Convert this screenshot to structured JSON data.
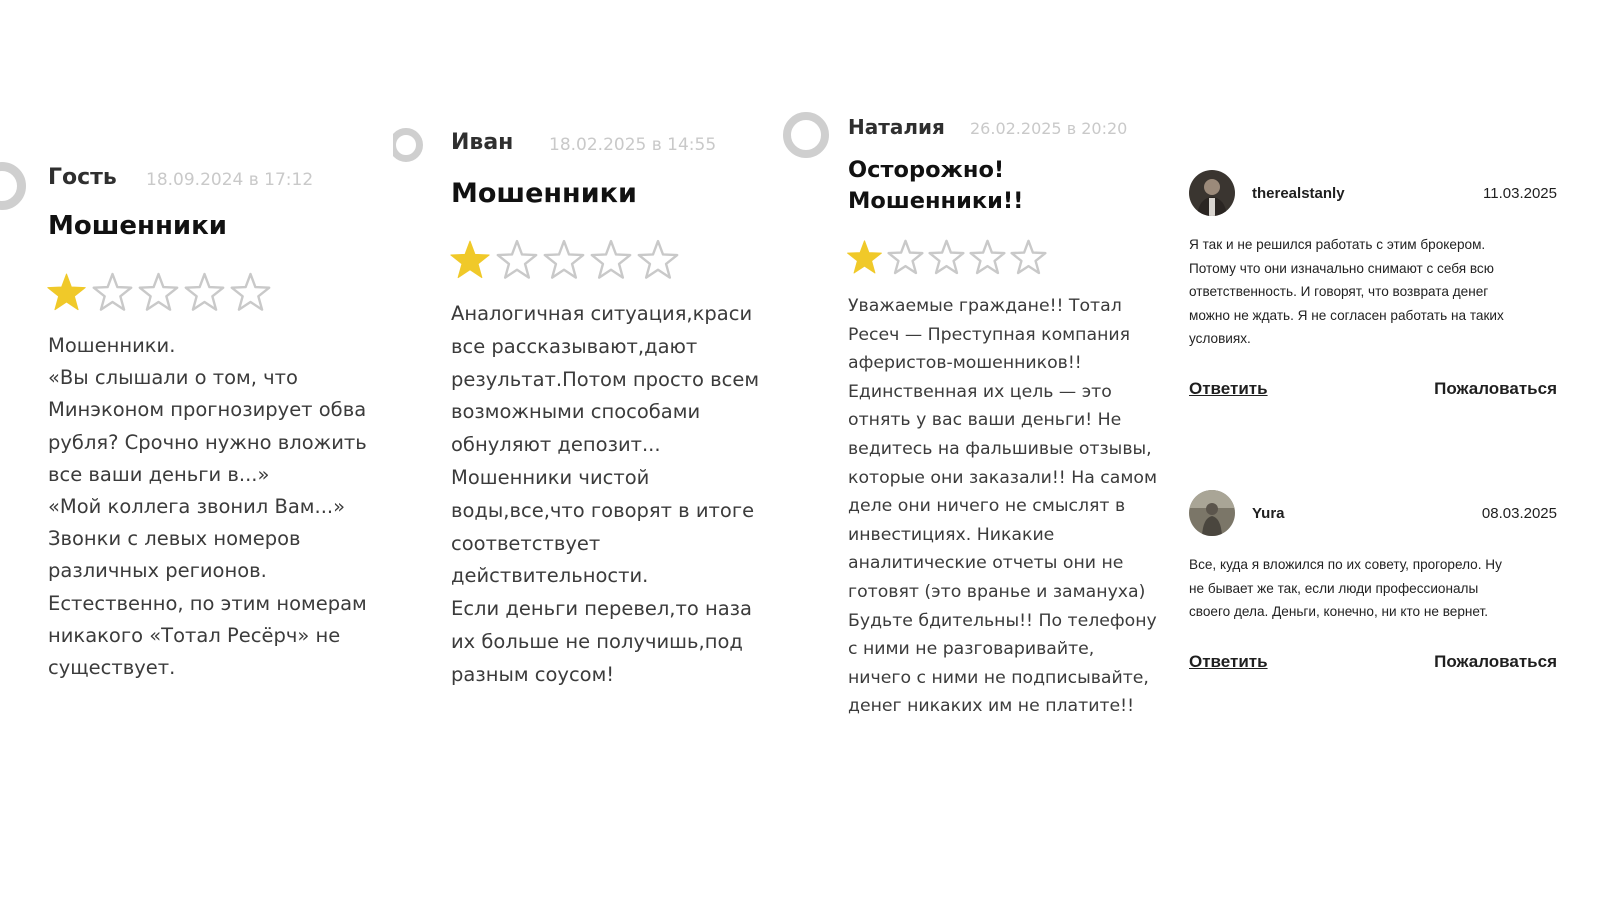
{
  "reviews": [
    {
      "author": "Гость",
      "date": "18.09.2024 в 17:12",
      "title": "Мошенники",
      "rating": 1,
      "max_rating": 5,
      "body": [
        "Мошенники.",
        "«Вы слышали о том, что",
        "Минэконом прогнозирует обва",
        "рубля? Срочно нужно вложить",
        "все ваши деньги в...»",
        "«Мой коллега звонил Вам...»",
        "Звонки с левых номеров",
        "различных регионов.",
        "Естественно, по этим номерам",
        "никакого «Тотал Ресёрч» не",
        "существует."
      ]
    },
    {
      "author": "Иван",
      "date": "18.02.2025 в 14:55",
      "title": "Мошенники",
      "rating": 1,
      "max_rating": 5,
      "body": [
        "Аналогичная ситуация,краси",
        "все рассказывают,дают",
        "результат.Потом просто всем",
        "возможными способами",
        "обнуляют депозит...",
        "Мошенники чистой",
        "воды,все,что говорят в итоге",
        "соответствует",
        "действительности.",
        "Если деньги перевел,то наза",
        "их больше не получишь,под",
        "разным соусом!"
      ]
    },
    {
      "author": "Наталия",
      "date": "26.02.2025 в 20:20",
      "title_lines": [
        "Осторожно!",
        "Мошенники!!"
      ],
      "rating": 1,
      "max_rating": 5,
      "body": [
        "Уважаемые граждане!! Тотал",
        "Ресеч — Преступная компания",
        "аферистов-мошенников!!",
        "Единственная их цель — это",
        "отнять у вас ваши деньги! Не",
        "ведитесь на фальшивые отзывы,",
        "которые они заказали!! На самом",
        "деле они ничего не смыслят в",
        "инвестициях. Никакие",
        "аналитические отчеты они не",
        "готовят (это вранье и замануха)",
        "Будьте бдительны!! По телефону",
        "с ними не разговаривайте,",
        "ничего с ними не подписывайте,",
        "денег никаких им не платите!!"
      ]
    }
  ],
  "comments": [
    {
      "user": "therealstanly",
      "date": "11.03.2025",
      "text": [
        "Я так и не решился работать с этим брокером.",
        "Потому что они изначально снимают с себя всю",
        "ответственность. И говорят, что возврата денег",
        "можно не ждать. Я не согласен работать на таких",
        "условиях."
      ],
      "reply_label": "Ответить",
      "report_label": "Пожаловаться"
    },
    {
      "user": "Yura",
      "date": "08.03.2025",
      "text": [
        "Все, куда я вложился по их совету, прогорело. Ну",
        "не бывает же так, если люди профессионалы",
        "своего дела. Деньги, конечно, ни кто не вернет."
      ],
      "reply_label": "Ответить",
      "report_label": "Пожаловаться"
    }
  ],
  "colors": {
    "star_filled": "#f0c929",
    "star_empty": "#c9c9c9",
    "avatar_ring": "#cfcfcf"
  }
}
